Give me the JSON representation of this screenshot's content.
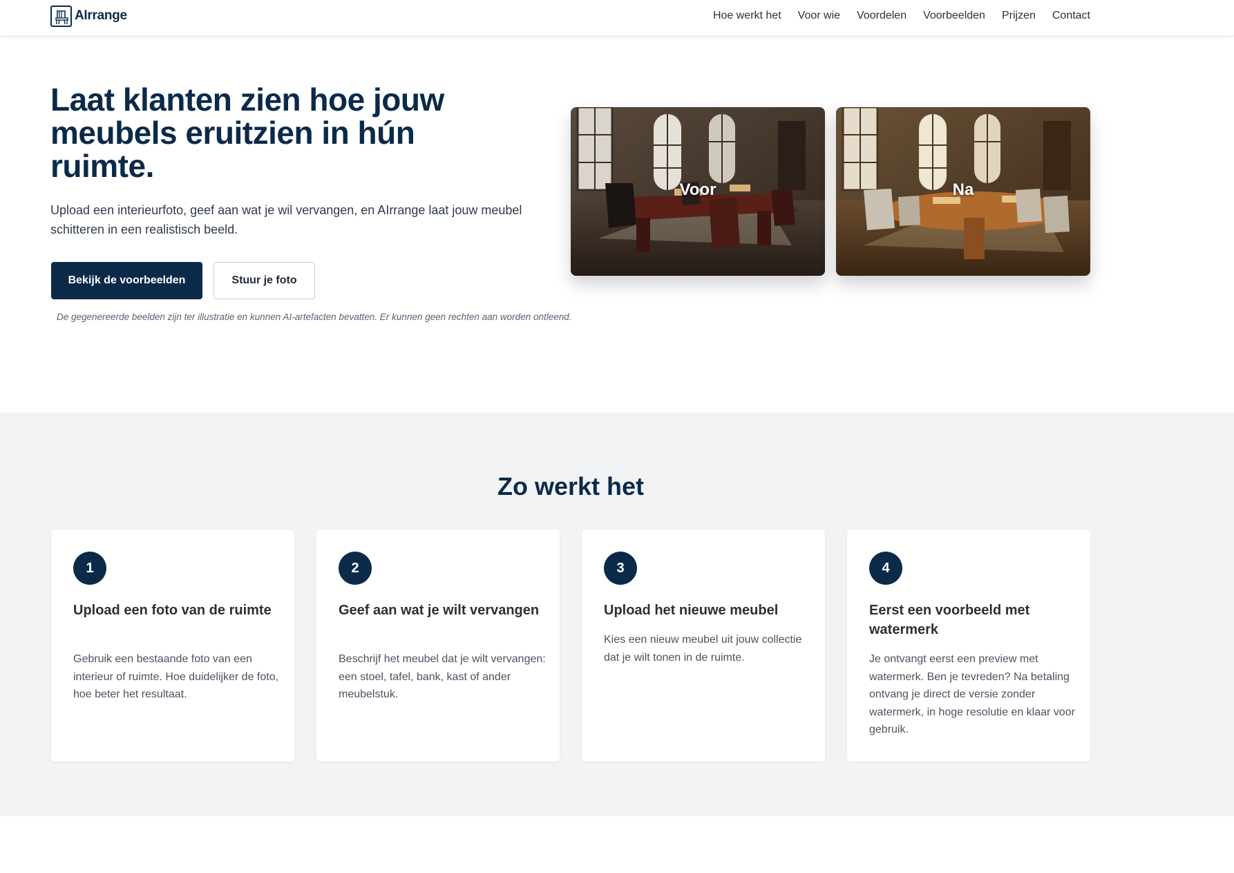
{
  "nav": {
    "logo_text": "AIrrange",
    "links": [
      "Hoe werkt het",
      "Voor wie",
      "Voordelen",
      "Voorbeelden",
      "Prijzen",
      "Contact"
    ]
  },
  "hero": {
    "title": "Laat klanten zien hoe jouw meubels eruitzien in hún ruimte.",
    "subtitle": "Upload een interieurfoto, geef aan wat je wil vervangen, en AIrrange laat jouw meubel schitteren in een realistisch beeld.",
    "primary_button": "Bekijk de voorbeelden",
    "secondary_button": "Stuur je foto",
    "disclaimer": "De gegenereerde beelden zijn ter illustratie en kunnen AI-artefacten bevatten. Er kunnen geen rechten aan worden ontleend.",
    "before_label": "Voor",
    "after_label": "Na"
  },
  "how": {
    "title": "Zo werkt het",
    "steps": [
      {
        "number": "1",
        "title": "Upload een foto van de ruimte",
        "text": "Gebruik een bestaande foto van een interieur of ruimte. Hoe duidelijker de foto, hoe beter het resultaat."
      },
      {
        "number": "2",
        "title": "Geef aan wat je wilt vervangen",
        "text": "Beschrijf het meubel dat je wilt vervangen: een stoel, tafel, bank, kast of ander meubelstuk."
      },
      {
        "number": "3",
        "title": "Upload het nieuwe meubel",
        "text": "Kies een nieuw meubel uit jouw collectie dat je wilt tonen in de ruimte."
      },
      {
        "number": "4",
        "title": "Eerst een voorbeeld met watermerk",
        "text": "Je ontvangt eerst een preview met watermerk. Ben je tevreden? Na betaling ontvang je direct de versie zonder watermerk, in hoge resolutie en klaar voor gebruik."
      }
    ]
  },
  "colors": {
    "brand": "#0b2a4a",
    "section_bg": "#f2f3f5"
  }
}
